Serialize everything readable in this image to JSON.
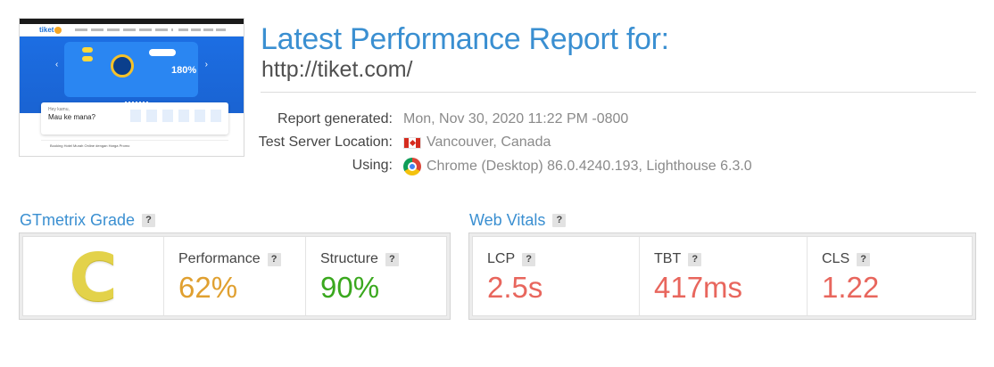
{
  "report": {
    "title": "Latest Performance Report for:",
    "url": "http://tiket.com/"
  },
  "thumbnail": {
    "logo": "tiket",
    "banner_number": "180%",
    "search_question": "Hey kamu,",
    "search_prompt": "Mau ke mana?",
    "row_text": "Booking Hotel Murah Online dengan Harga Promo"
  },
  "info": [
    {
      "label": "Report generated:",
      "value": "Mon, Nov 30, 2020 11:22 PM -0800",
      "icon": ""
    },
    {
      "label": "Test Server Location:",
      "value": "Vancouver, Canada",
      "icon": "canada-flag-icon"
    },
    {
      "label": "Using:",
      "value": "Chrome (Desktop) 86.0.4240.193, Lighthouse 6.3.0",
      "icon": "chrome-icon"
    }
  ],
  "gtmetrix": {
    "heading": "GTmetrix Grade",
    "help": "?",
    "grade": "C",
    "grade_color": "#e3d24a",
    "performance": {
      "label": "Performance",
      "value": "62%",
      "color": "#e0a030"
    },
    "structure": {
      "label": "Structure",
      "value": "90%",
      "color": "#3aa81e"
    }
  },
  "web_vitals": {
    "heading": "Web Vitals",
    "help": "?",
    "lcp": {
      "label": "LCP",
      "value": "2.5s",
      "color": "#e8665d"
    },
    "tbt": {
      "label": "TBT",
      "value": "417ms",
      "color": "#e8665d"
    },
    "cls": {
      "label": "CLS",
      "value": "1.22",
      "color": "#e8665d"
    }
  }
}
